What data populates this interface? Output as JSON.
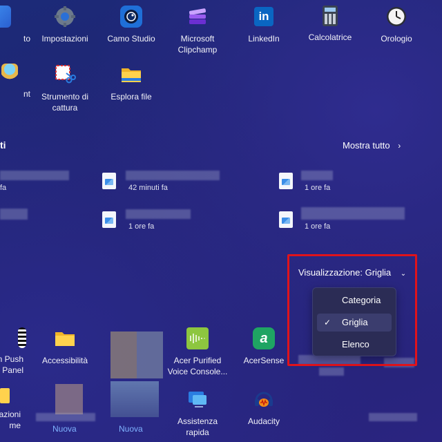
{
  "pinned_row1": [
    {
      "label": "to",
      "icon": "app-icon"
    },
    {
      "label": "Impostazioni",
      "icon": "gear-icon"
    },
    {
      "label": "Camo Studio",
      "icon": "camo-studio-icon"
    },
    {
      "label": "Microsoft Clipchamp",
      "icon": "clipchamp-icon"
    },
    {
      "label": "LinkedIn",
      "icon": "linkedin-icon"
    },
    {
      "label": "Calcolatrice",
      "icon": "calculator-icon"
    },
    {
      "label": "Orologio",
      "icon": "clock-icon"
    }
  ],
  "pinned_row2": [
    {
      "label": "nt",
      "icon": "paint-icon"
    },
    {
      "label": "Strumento di cattura",
      "icon": "snipping-tool-icon"
    },
    {
      "label": "Esplora file",
      "icon": "file-explorer-icon"
    }
  ],
  "recommended": {
    "title_fragment": "ti",
    "show_all_label": "Mostra tutto",
    "items": [
      {
        "time": "fa"
      },
      {
        "time": "42 minuti fa"
      },
      {
        "time": "1 ore fa"
      },
      {
        "time": "1 ore fa"
      },
      {
        "time": "1 ore fa"
      }
    ]
  },
  "view": {
    "label": "Visualizzazione: Griglia",
    "options": [
      "Categoria",
      "Griglia",
      "Elenco"
    ],
    "selected": "Griglia",
    "highlight_color": "#e0131b"
  },
  "all_apps_row1": [
    {
      "label_line1": "n Push",
      "label_line2": "l Panel",
      "icon": "calculator-grid-icon"
    },
    {
      "label_line1": "Accessibilità",
      "label_line2": "",
      "icon": "folder-icon"
    },
    {
      "label_line1": "Acer Purified",
      "label_line2": "Voice Console...",
      "icon": "acer-purified-voice-icon"
    },
    {
      "label_line1": "AcerSense",
      "label_line2": "",
      "icon": "acersense-icon"
    }
  ],
  "all_apps_row2": [
    {
      "label_line1": "azioni",
      "label_line2": "me",
      "icon": "folder-icon"
    },
    {
      "label_line1": "Nuova",
      "label_line2": "",
      "icon": "app-icon"
    },
    {
      "label_line1": "Nuova",
      "label_line2": "",
      "icon": "app-icon"
    },
    {
      "label_line1": "Assistenza",
      "label_line2": "rapida",
      "icon": "quick-assist-icon"
    },
    {
      "label_line1": "Audacity",
      "label_line2": "",
      "icon": "audacity-icon"
    }
  ]
}
